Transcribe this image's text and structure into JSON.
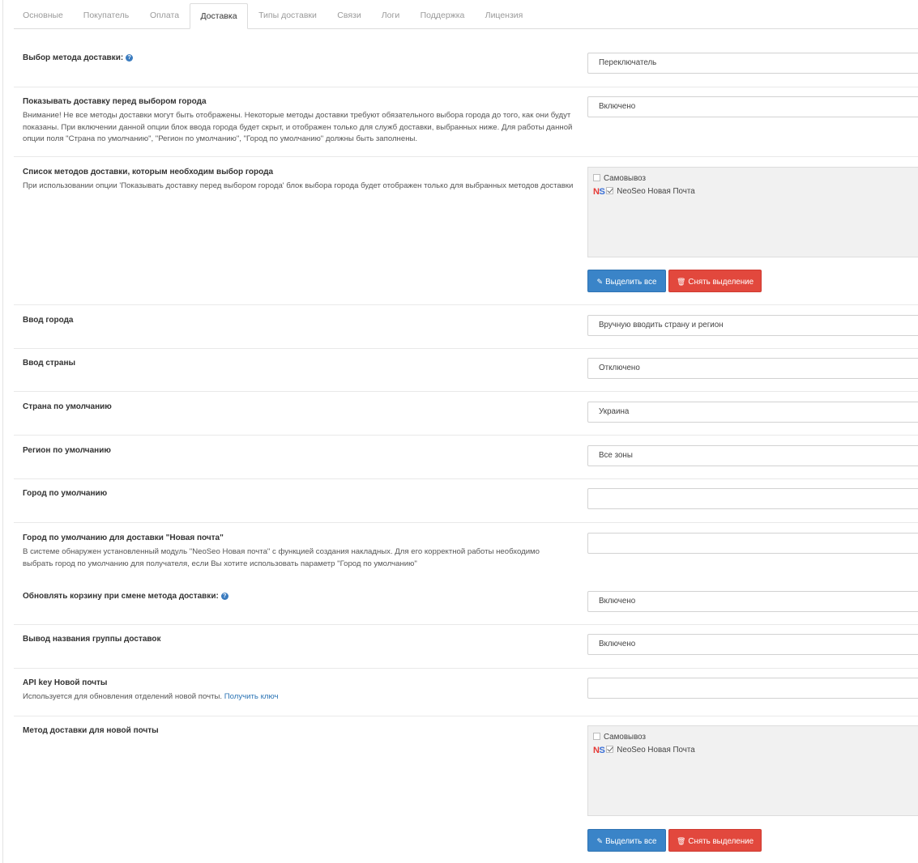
{
  "tabs": [
    "Основные",
    "Покупатель",
    "Оплата",
    "Доставка",
    "Типы доставки",
    "Связи",
    "Логи",
    "Поддержка",
    "Лицензия"
  ],
  "active_tab": "Доставка",
  "fields": {
    "method_select": {
      "label": "Выбор метода доставки:",
      "value": "Переключатель",
      "help_icon": "question-icon"
    },
    "show_before_city": {
      "label": "Показывать доставку перед выбором города",
      "help": "Внимание! Не все методы доставки могут быть отображены. Некоторые методы доставки требуют обязательного выбора города до того, как они будут показаны. При включении данной опции блок ввода города будет скрыт, и отображен только для служб доставки, выбранных ниже. Для работы данной опции поля \"Страна по умолчанию\", \"Регион по умолчанию\", \"Город по умолчанию\" должны быть заполнены.",
      "value": "Включено"
    },
    "city_methods": {
      "label": "Список методов доставки, которым необходим выбор города",
      "help": "При использовании опции 'Показывать доставку перед выбором города' блок выбора города будет отображен только для выбранных методов доставки",
      "items": [
        {
          "label": "Самовывоз",
          "checked": false,
          "logo": ""
        },
        {
          "label": "NeoSeo Новая Почта",
          "checked": true,
          "logo": "NS"
        }
      ],
      "select_all": "Выделить все",
      "deselect": "Снять выделение"
    },
    "city_input": {
      "label": "Ввод города",
      "value": "Вручную вводить страну и регион"
    },
    "country_input": {
      "label": "Ввод страны",
      "value": "Отключено"
    },
    "default_country": {
      "label": "Страна по умолчанию",
      "value": "Украина"
    },
    "default_region": {
      "label": "Регион по умолчанию",
      "value": "Все зоны"
    },
    "default_city": {
      "label": "Город по умолчанию",
      "value": ""
    },
    "np_default_city": {
      "label": "Город по умолчанию для доставки \"Новая почта\"",
      "help": "В системе обнаружен установленный модуль \"NeoSeo Новая почта\" с функцией создания накладных. Для его корректной работы необходимо выбрать город по умолчанию для получателя, если Вы хотите использовать параметр \"Город по умолчанию\"",
      "value": ""
    },
    "refresh_cart": {
      "label": "Обновлять корзину при смене метода доставки:",
      "value": "Включено",
      "help_icon": "question-icon"
    },
    "group_names": {
      "label": "Вывод названия группы доставок",
      "value": "Включено"
    },
    "np_api_key": {
      "label": "API key Новой почты",
      "help": "Используется для обновления отделений новой почты.",
      "link": "Получить ключ",
      "value": ""
    },
    "np_method": {
      "label": "Метод доставки для новой почты",
      "items": [
        {
          "label": "Самовывоз",
          "checked": false,
          "logo": ""
        },
        {
          "label": "NeoSeo Новая Почта",
          "checked": true,
          "logo": "NS"
        }
      ],
      "select_all": "Выделить все",
      "deselect": "Снять выделение"
    }
  }
}
